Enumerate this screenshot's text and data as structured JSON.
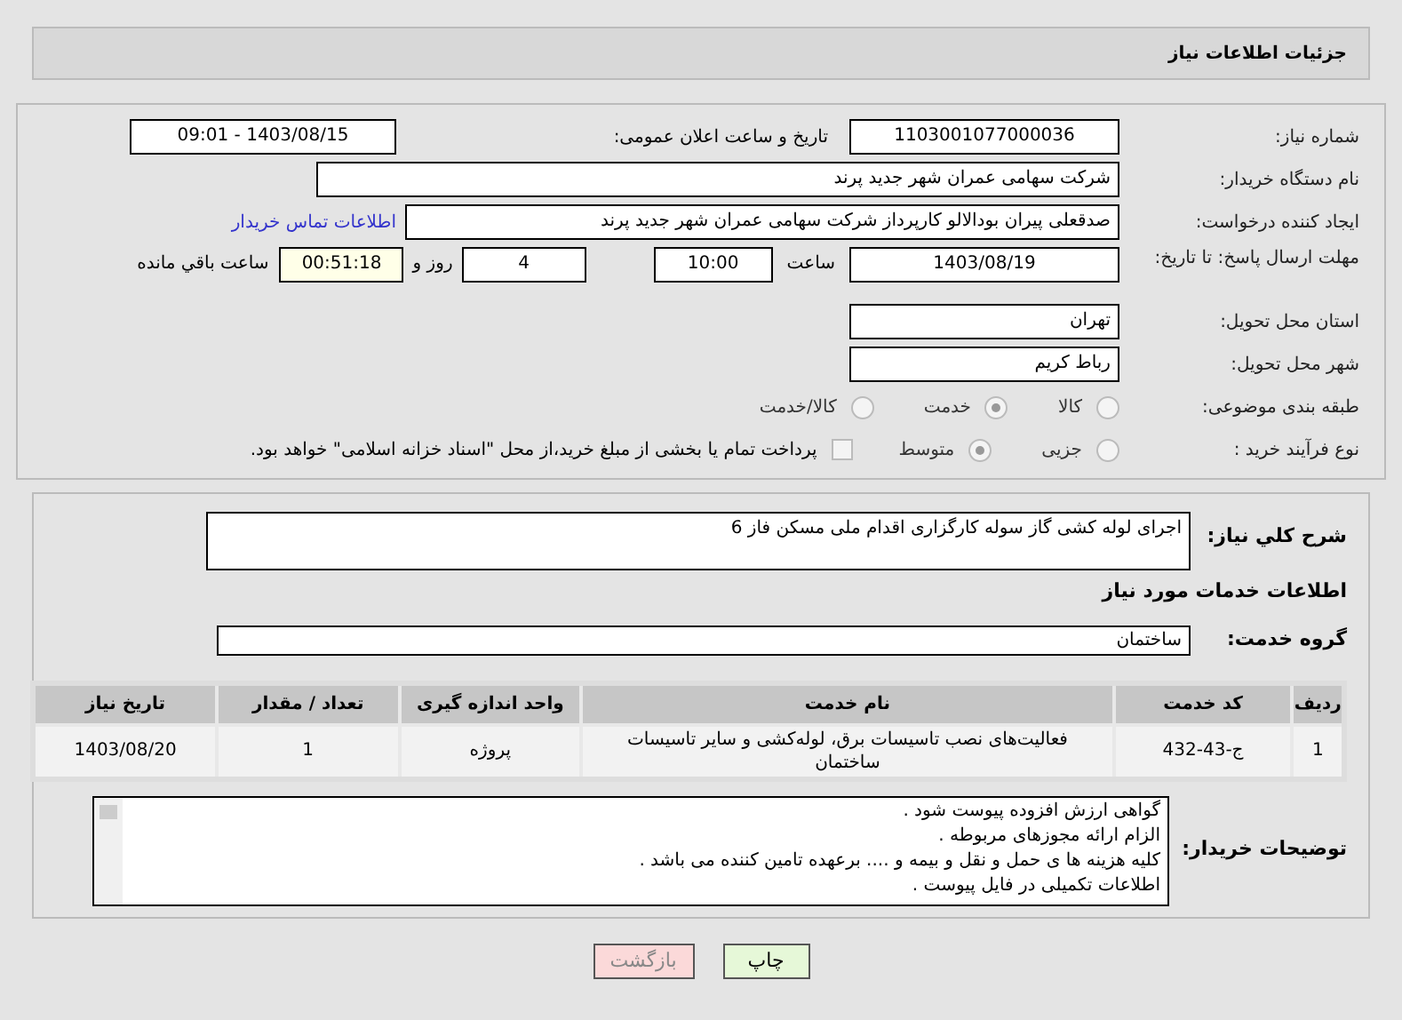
{
  "header": {
    "title": "جزئیات اطلاعات نیاز"
  },
  "fields": {
    "need_number": {
      "label": "شماره نیاز:",
      "value": "1103001077000036"
    },
    "announce": {
      "label": "تاریخ و ساعت اعلان عمومی:",
      "value": "1403/08/15 - 09:01"
    },
    "buyer": {
      "label": "نام دستگاه خریدار:",
      "value": "شرکت سهامی عمران شهر جدید پرند"
    },
    "creator": {
      "label": "ایجاد کننده درخواست:",
      "value": "صدقعلی پیران بودالالو کارپرداز شرکت سهامی عمران شهر جدید پرند",
      "link": "اطلاعات تماس خریدار"
    },
    "deadline": {
      "label": "مهلت ارسال پاسخ: تا تاریخ:",
      "date": "1403/08/19",
      "time_label": "ساعت",
      "time": "10:00",
      "days": "4",
      "days_label": "روز و",
      "remaining": "00:51:18",
      "remaining_label": "ساعت باقي مانده"
    },
    "province": {
      "label": "استان محل تحویل:",
      "value": "تهران"
    },
    "city": {
      "label": "شهر محل تحویل:",
      "value": "رباط کریم"
    }
  },
  "category": {
    "label": "طبقه بندی موضوعی:",
    "options": [
      {
        "label": "کالا",
        "selected": false
      },
      {
        "label": "خدمت",
        "selected": true
      },
      {
        "label": "کالا/خدمت",
        "selected": false
      }
    ]
  },
  "process": {
    "label": "نوع فرآیند خرید :",
    "options": [
      {
        "label": "جزیی",
        "selected": false
      },
      {
        "label": "متوسط",
        "selected": true
      }
    ],
    "treasury": {
      "checked": false,
      "label": "پرداخت تمام یا بخشی از مبلغ خرید،از محل \"اسناد خزانه اسلامی\" خواهد بود."
    }
  },
  "description": {
    "label": "شرح کلي نیاز:",
    "value": "اجرای لوله کشی گاز سوله کارگزاری اقدام ملی مسکن فاز 6"
  },
  "services_title": "اطلاعات خدمات مورد نیاز",
  "service_group": {
    "label": "گروه خدمت:",
    "value": "ساختمان"
  },
  "table": {
    "columns": [
      "ردیف",
      "کد خدمت",
      "نام خدمت",
      "واحد اندازه گیری",
      "تعداد / مقدار",
      "تاریخ نیاز"
    ],
    "rows": [
      [
        "1",
        "ج-43-432",
        "فعالیت‌های نصب تاسیسات برق، لوله‌کشی و سایر تاسیسات ساختمان",
        "پروژه",
        "1",
        "1403/08/20"
      ]
    ]
  },
  "buyer_notes": {
    "label": "توضیحات خریدار:",
    "lines": [
      "گواهی ارزش افزوده پیوست شود .",
      "الزام ارائه مجوزهای مربوطه .",
      "کلیه هزینه ها ی حمل و نقل و بیمه و .... برعهده تامین کننده می باشد .",
      "اطلاعات تکمیلی در فایل پیوست ."
    ]
  },
  "buttons": [
    {
      "label": "چاپ",
      "kind": "print"
    },
    {
      "label": "بازگشت",
      "kind": "back"
    }
  ]
}
